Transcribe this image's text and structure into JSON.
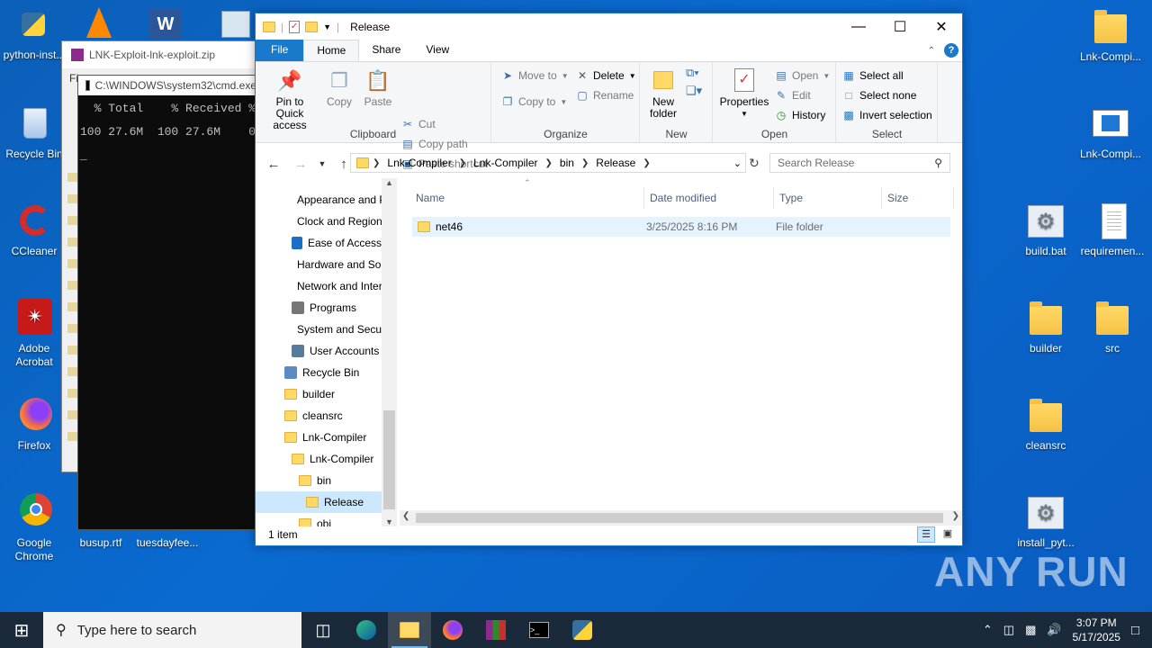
{
  "desktop": {
    "left_icons": [
      {
        "name": "python-inst...",
        "icon": "python-installer-icon"
      },
      {
        "name": "Recycle Bin",
        "icon": "recycle-bin-icon"
      },
      {
        "name": "CCleaner",
        "icon": "ccleaner-icon"
      },
      {
        "name": "Adobe Acrobat",
        "icon": "acrobat-icon"
      },
      {
        "name": "Firefox",
        "icon": "firefox-icon"
      },
      {
        "name": "Google Chrome",
        "icon": "chrome-icon"
      },
      {
        "name": "busup.rtf",
        "icon": "rtf-file-icon"
      },
      {
        "name": "tuesdayfee...",
        "icon": "file-icon"
      }
    ],
    "right_icons": [
      {
        "name": "Lnk-Compi...",
        "icon": "folder-icon"
      },
      {
        "name": "Lnk-Compi...",
        "icon": "window-app-icon"
      },
      {
        "name": "build.bat",
        "icon": "batch-file-icon"
      },
      {
        "name": "requiremen...",
        "icon": "text-file-icon"
      },
      {
        "name": "builder",
        "icon": "folder-icon"
      },
      {
        "name": "src",
        "icon": "folder-icon"
      },
      {
        "name": "cleansrc",
        "icon": "folder-icon"
      },
      {
        "name": "install_pyt...",
        "icon": "batch-file-icon"
      }
    ],
    "watermark": "ANY RUN"
  },
  "winrar": {
    "title": "LNK-Exploit-lnk-exploit.zip",
    "menu_first": "Fi"
  },
  "cmd": {
    "title": "C:\\WINDOWS\\system32\\cmd.exe",
    "line1": "  % Total    % Received % Xferd",
    "line2": "100 27.6M  100 27.6M    0",
    "line3": "_"
  },
  "explorer": {
    "title": "Release",
    "tabs": [
      "File",
      "Home",
      "Share",
      "View"
    ],
    "ribbon": {
      "clipboard": {
        "label": "Clipboard",
        "pin": "Pin to Quick access",
        "copy": "Copy",
        "paste": "Paste",
        "cut": "Cut",
        "copy_path": "Copy path",
        "paste_shortcut": "Paste shortcut"
      },
      "organize": {
        "label": "Organize",
        "move_to": "Move to",
        "copy_to": "Copy to",
        "delete": "Delete",
        "rename": "Rename"
      },
      "new": {
        "label": "New",
        "new_folder": "New folder"
      },
      "open": {
        "label": "Open",
        "properties": "Properties",
        "open": "Open",
        "edit": "Edit",
        "history": "History"
      },
      "select": {
        "label": "Select",
        "select_all": "Select all",
        "select_none": "Select none",
        "invert": "Invert selection"
      }
    },
    "breadcrumbs": [
      "Lnk-Compiler",
      "Lnk-Compiler",
      "bin",
      "Release"
    ],
    "search_placeholder": "Search Release",
    "nav": [
      {
        "label": "Appearance and Personalization",
        "kind": "cp",
        "indent": 40
      },
      {
        "label": "Clock and Region",
        "kind": "cp",
        "indent": 40
      },
      {
        "label": "Ease of Access",
        "kind": "cp",
        "indent": 40
      },
      {
        "label": "Hardware and Sound",
        "kind": "cp",
        "indent": 40
      },
      {
        "label": "Network and Internet",
        "kind": "cp",
        "indent": 40
      },
      {
        "label": "Programs",
        "kind": "cp",
        "indent": 40
      },
      {
        "label": "System and Security",
        "kind": "cp",
        "indent": 40
      },
      {
        "label": "User Accounts",
        "kind": "cp",
        "indent": 40
      },
      {
        "label": "Recycle Bin",
        "kind": "cp",
        "indent": 32
      },
      {
        "label": "builder",
        "kind": "folder",
        "indent": 32
      },
      {
        "label": "cleansrc",
        "kind": "folder",
        "indent": 32
      },
      {
        "label": "Lnk-Compiler",
        "kind": "folder",
        "indent": 32
      },
      {
        "label": "Lnk-Compiler",
        "kind": "folder",
        "indent": 40
      },
      {
        "label": "bin",
        "kind": "folder",
        "indent": 48
      },
      {
        "label": "Release",
        "kind": "folder",
        "indent": 56,
        "selected": true
      },
      {
        "label": "obj",
        "kind": "folder",
        "indent": 48
      }
    ],
    "columns": [
      "Name",
      "Date modified",
      "Type",
      "Size"
    ],
    "files": [
      {
        "name": "net46",
        "date": "3/25/2025 8:16 PM",
        "type": "File folder",
        "size": ""
      }
    ],
    "status": "1 item"
  },
  "taskbar": {
    "search_placeholder": "Type here to search",
    "time": "3:07 PM",
    "date": "5/17/2025"
  }
}
